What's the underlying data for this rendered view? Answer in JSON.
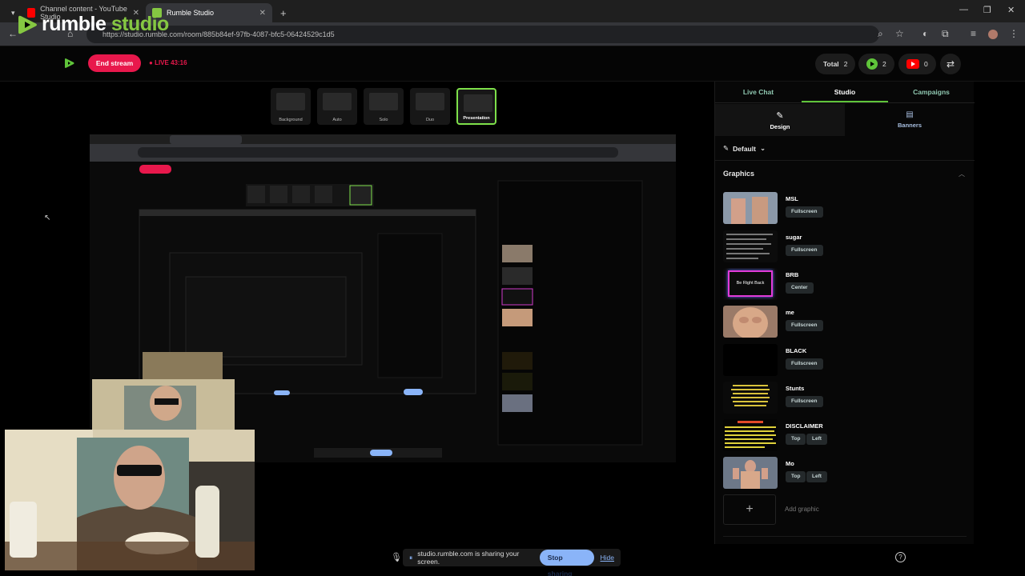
{
  "browser": {
    "tabs": [
      {
        "title": "Channel content - YouTube Studio",
        "active": false
      },
      {
        "title": "Rumble Studio",
        "active": true
      }
    ],
    "url": "https://studio.rumble.com/room/885b84ef-97fb-4087-bfc5-06424529c1d5"
  },
  "logo": {
    "text": "rumble",
    "accent": "studio"
  },
  "header": {
    "end_stream": "End stream",
    "live": "LIVE 43:16",
    "total_label": "Total",
    "total_value": "2",
    "rumble_count": "2",
    "youtube_count": "0"
  },
  "layouts": [
    "Background",
    "Auto",
    "Solo",
    "Duo",
    "Presentation"
  ],
  "sidebar": {
    "tabs": [
      "Live Chat",
      "Studio",
      "Campaigns"
    ],
    "subtabs": [
      "Design",
      "Banners"
    ],
    "preset": "Default",
    "graphics_title": "Graphics",
    "graphics": [
      {
        "name": "MSL",
        "tags": [
          "Fullscreen"
        ]
      },
      {
        "name": "sugar",
        "tags": [
          "Fullscreen"
        ]
      },
      {
        "name": "BRB",
        "tags": [
          "Center"
        ]
      },
      {
        "name": "me",
        "tags": [
          "Fullscreen"
        ]
      },
      {
        "name": "BLACK",
        "tags": [
          "Fullscreen"
        ]
      },
      {
        "name": "Stunts",
        "tags": [
          "Fullscreen"
        ]
      },
      {
        "name": "DISCLAIMER",
        "tags": [
          "Top",
          "Left"
        ]
      },
      {
        "name": "Mo",
        "tags": [
          "Top",
          "Left"
        ]
      }
    ],
    "add_graphic": "Add graphic",
    "brb_thumb_text": "Be Right Back"
  },
  "share": {
    "message": "studio.rumble.com is sharing your screen.",
    "stop": "Stop sharing",
    "hide": "Hide"
  },
  "colors": {
    "accent": "#5fc43a",
    "end": "#e8184c",
    "share_btn": "#8ab4f8"
  }
}
